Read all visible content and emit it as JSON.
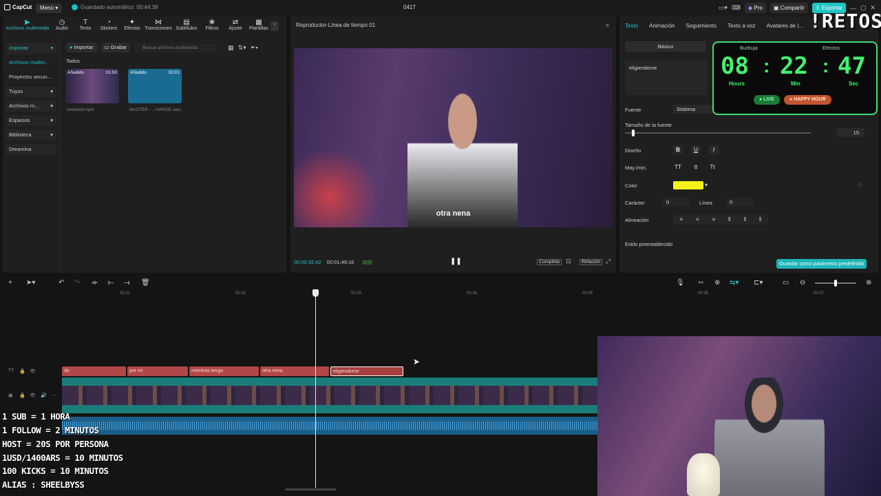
{
  "titlebar": {
    "app_name": "CapCut",
    "menu_label": "Menú",
    "autosave": "Guardado automático: 00:44:39",
    "project_title": "0417",
    "pro_label": "Pro",
    "share_label": "Compartir",
    "export_label": "Exportar"
  },
  "media_tabs": [
    {
      "label": "Archivos multimedia",
      "icon": "media-icon",
      "active": true
    },
    {
      "label": "Audio",
      "icon": "audio-icon"
    },
    {
      "label": "Texto",
      "icon": "text-icon"
    },
    {
      "label": "Stickers",
      "icon": "sticker-icon"
    },
    {
      "label": "Efectos",
      "icon": "effects-icon"
    },
    {
      "label": "Transiciones",
      "icon": "transitions-icon"
    },
    {
      "label": "Subtítulos",
      "icon": "subtitles-icon"
    },
    {
      "label": "Filtros",
      "icon": "filters-icon"
    },
    {
      "label": "Ajuste",
      "icon": "adjust-icon"
    },
    {
      "label": "Plantillas",
      "icon": "templates-icon"
    }
  ],
  "sidebar": {
    "items": [
      {
        "label": "Importar",
        "chevron": true
      },
      {
        "label": "Archivos multim...",
        "active": true
      },
      {
        "label": "Proyectos secun..."
      },
      {
        "label": "Tuyos",
        "chevron": true
      },
      {
        "label": "Archivos m...",
        "chevron": true
      },
      {
        "label": "Espacios",
        "chevron": true
      },
      {
        "label": "Biblioteca",
        "chevron": true
      },
      {
        "label": "Dreamina"
      }
    ]
  },
  "media": {
    "import_label": "Importar",
    "record_label": "Grabar",
    "search_placeholder": "Buscar archivos multimedia",
    "section_title": "Todos",
    "items": [
      {
        "badge": "Añadido",
        "duration": "01:50",
        "name": "oneshott.mp4"
      },
      {
        "badge": "Añadido",
        "duration": "02:01",
        "name": "MASTER - ...HARGE.wav"
      }
    ]
  },
  "player": {
    "title": "Reproductor-Línea de tiempo 01",
    "subtitle": "otra nena",
    "current_time": "00:00:32:42",
    "total_time": "00:01:49:16",
    "full_label": "Completa",
    "ratio_label": "Relación"
  },
  "properties": {
    "tabs": [
      "Texto",
      "Animación",
      "Seguimiento",
      "Texto a voz",
      "Avatares de I..."
    ],
    "basic_tab": "Básico",
    "bubble_tab": "Burbuja",
    "effects_tab": "Efectos",
    "text_value": "eligiendome",
    "font_label": "Fuente",
    "font_value": "Sistema",
    "size_label": "Tamaño de la fuente",
    "size_value": "15",
    "design_label": "Diseño",
    "case_label": "May./min.",
    "case_options": [
      "TT",
      "tt",
      "Tt"
    ],
    "color_label": "Color",
    "color_value": "#f4f41c",
    "spacing_label": "Carácter",
    "spacing_value": "0",
    "line_label": "Línea",
    "line_value": "0",
    "align_label": "Alineación",
    "preset_label": "Estilo preestablecido",
    "save_preset_label": "Guardar como parámetro predefinido"
  },
  "timer": {
    "hours": "08",
    "minutes": "22",
    "seconds": "47",
    "hours_label": "Hours",
    "minutes_label": "Min",
    "seconds_label": "Sec",
    "live_label": "LIVE",
    "happy_label": "HAPPY HOUR",
    "color": "#43f26f"
  },
  "retos_label": "!RETOS",
  "timeline": {
    "ticks": [
      "00:31",
      "00:32",
      "00:33",
      "00:34",
      "00:35",
      "00:36",
      "00:37"
    ],
    "text_clips": [
      {
        "label": "do"
      },
      {
        "label": "por mi"
      },
      {
        "label": "mientras tengo"
      },
      {
        "label": "otra nena"
      },
      {
        "label": "eligiendome",
        "selected": true
      }
    ]
  },
  "overlay_lines": [
    "1 SUB = 1 HORA",
    "1 FOLLOW = 2 MINUTOS",
    "HOST = 20S POR PERSONA",
    "1USD/1400ARS = 10 MINUTOS",
    "100 KICKS = 10 MINUTOS",
    "ALIAS : SHEELBYSS"
  ]
}
